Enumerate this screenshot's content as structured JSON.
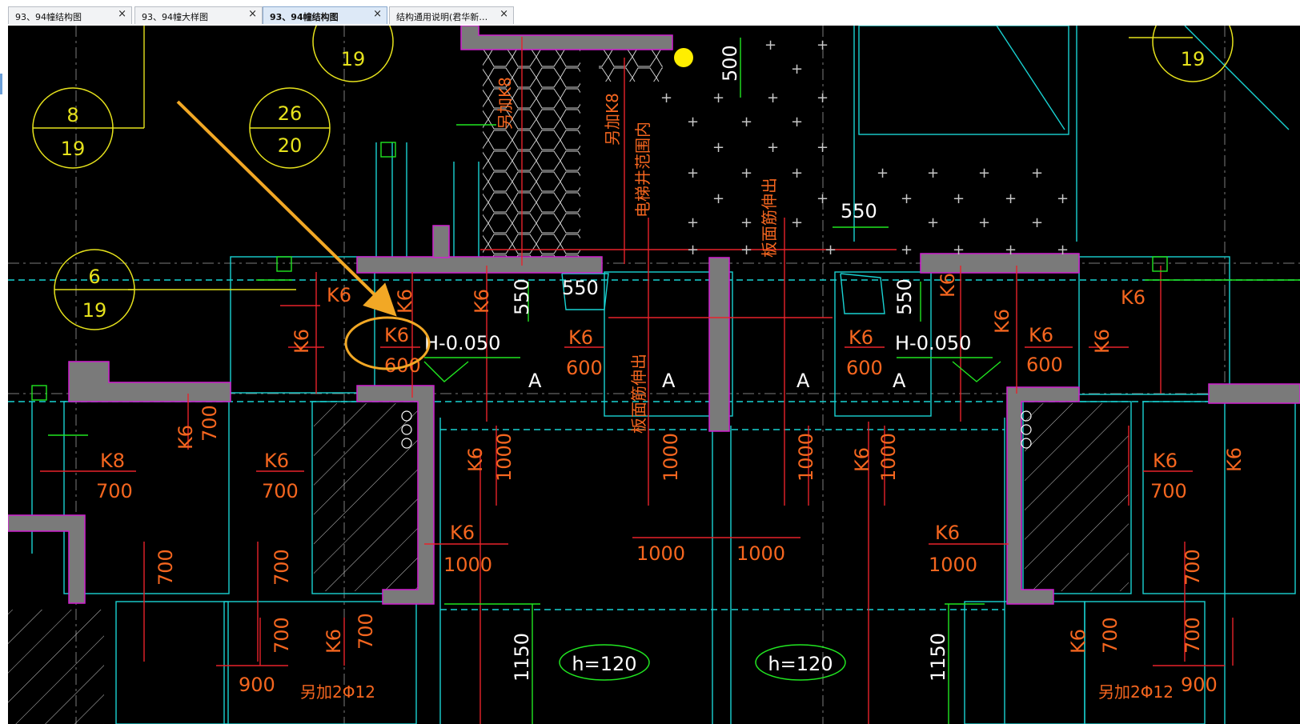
{
  "tabs": [
    {
      "label": "93、94幢结构图",
      "close": "×",
      "active": false
    },
    {
      "label": "93、94幢大样图",
      "close": "×",
      "active": false
    },
    {
      "label": "93、94幢结构图",
      "close": "×",
      "active": true
    },
    {
      "label": "结构通用说明(君华新…",
      "close": "×",
      "active": false
    }
  ],
  "drawing": {
    "colors": {
      "background": "#000000",
      "cyan": "#19d2d2",
      "red": "#e8232a",
      "orange": "#f5661f",
      "yellow": "#e6e21c",
      "green": "#21e621",
      "wall_fill": "#7a7a7a",
      "wall_outline": "#d01fd0",
      "arrow": "#f2a825"
    },
    "bubbles": [
      {
        "top": "8",
        "bottom": "19"
      },
      {
        "top": "26",
        "bottom": "20"
      },
      {
        "top": "6",
        "bottom": "19"
      },
      {
        "top": "",
        "bottom": "19"
      },
      {
        "top": "",
        "bottom": "19"
      }
    ],
    "rebar_marks": {
      "k6": "K6",
      "k8": "K8"
    },
    "lengths": {
      "d600": "600",
      "d700": "700",
      "d900": "900",
      "d1000": "1000",
      "d1150": "1150"
    },
    "dims": {
      "d550": "550",
      "d500": "500"
    },
    "elevation": "H-0.050",
    "section_mark": "A",
    "slab_thickness": "h=120",
    "notes": {
      "extra_k8": "另加K8",
      "elevator_note": "电梯井范围内",
      "slab_rebar_extend": "板面筋伸出",
      "extra_bars": "另加2Φ12"
    }
  }
}
